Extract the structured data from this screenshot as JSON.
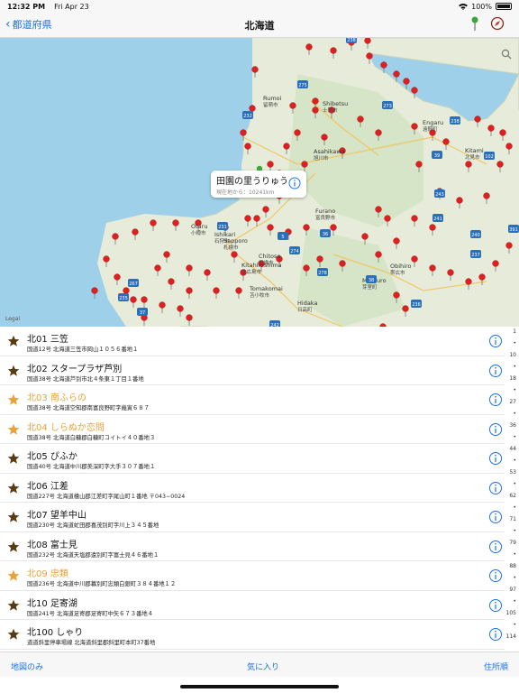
{
  "status": {
    "time": "12:32 PM",
    "date": "Fri Apr 23",
    "battery": "100%"
  },
  "nav": {
    "back_label": "都道府県",
    "title": "北海道"
  },
  "map": {
    "callout_title": "田園の里うりゅう",
    "callout_subtitle": "現在地から：10241km",
    "legal": "Legal",
    "cities": [
      {
        "name": "Asahikawa",
        "ja": "旭川市"
      },
      {
        "name": "Sapporo",
        "ja": "札幌市"
      },
      {
        "name": "Otaru",
        "ja": "小樽市"
      },
      {
        "name": "Obihiro",
        "ja": "帯広市"
      },
      {
        "name": "Kitami",
        "ja": "北見市"
      },
      {
        "name": "Tomakomai",
        "ja": "苫小牧市"
      },
      {
        "name": "Chitose",
        "ja": "千歳市"
      },
      {
        "name": "Furano",
        "ja": "富良野市"
      },
      {
        "name": "Shibetsu",
        "ja": "士別市"
      },
      {
        "name": "Engaru",
        "ja": "遠軽町"
      },
      {
        "name": "Rumoi",
        "ja": "留萌市"
      },
      {
        "name": "Memuro",
        "ja": "芽室町"
      },
      {
        "name": "Hidaka",
        "ja": "日高町"
      },
      {
        "name": "Ishikari",
        "ja": "石狩市"
      },
      {
        "name": "Bibai",
        "ja": "美唄市"
      },
      {
        "name": "Kitahiroshima",
        "ja": "北広島市"
      }
    ],
    "routes": [
      "238",
      "275",
      "232",
      "273",
      "238",
      "39",
      "102",
      "451",
      "243",
      "231",
      "241",
      "5",
      "274",
      "267",
      "36",
      "278",
      "38",
      "236",
      "235",
      "37",
      "242",
      "240",
      "391",
      "237"
    ]
  },
  "list": [
    {
      "name": "北01 三笠",
      "addr": "国道12号 北海道三笠市岡山１０５６番地１",
      "fav": false
    },
    {
      "name": "北02 スタープラザ芦別",
      "addr": "国道38号 北海道芦別市北４条東１丁目１番地",
      "fav": false
    },
    {
      "name": "北03 南ふらの",
      "addr": "国道38号 北海道空知郡南富良野町字幾寅６８７",
      "fav": true
    },
    {
      "name": "北04 しらぬか恋問",
      "addr": "国道38号 北海道白糠郡白糠町コイトイ４０番地３",
      "fav": true
    },
    {
      "name": "北05 ぴふか",
      "addr": "国道40号 北海道中川郡美深町字大手３０７番地１",
      "fav": false
    },
    {
      "name": "北06 江差",
      "addr": "国道227号 北海道檜山郡江差町字尾山町１番地 〒043−0024",
      "fav": false
    },
    {
      "name": "北07 望羊中山",
      "addr": "国道230号 北海道虻田郡喜茂別町字川上３４５番地",
      "fav": false
    },
    {
      "name": "北08 富士見",
      "addr": "国道232号 北海道天塩郡遠別町字富士見４６番地１",
      "fav": false
    },
    {
      "name": "北09 忠類",
      "addr": "国道236号 北海道中川郡幕別町忠類白銀町３８４番地１２",
      "fav": true
    },
    {
      "name": "北10 足寄湖",
      "addr": "国道241号 北海道足寄郡足寄町中矢６７３番地４",
      "fav": false
    },
    {
      "name": "北100 しゃり",
      "addr": "道道斜里停車場線 北海道斜里郡斜里町本町37番地",
      "fav": false
    }
  ],
  "index": [
    "1",
    "•",
    "10",
    "•",
    "18",
    "•",
    "27",
    "•",
    "36",
    "•",
    "44",
    "•",
    "53",
    "•",
    "62",
    "•",
    "71",
    "•",
    "79",
    "•",
    "88",
    "•",
    "97",
    "•",
    "105",
    "•",
    "114"
  ],
  "toolbar": {
    "left": "地図のみ",
    "center": "気に入り",
    "right": "住所順"
  },
  "colors": {
    "accent": "#1a73e8",
    "pin": "#e02020",
    "favorite": "#e8a23a",
    "star": "#5a3a10"
  }
}
